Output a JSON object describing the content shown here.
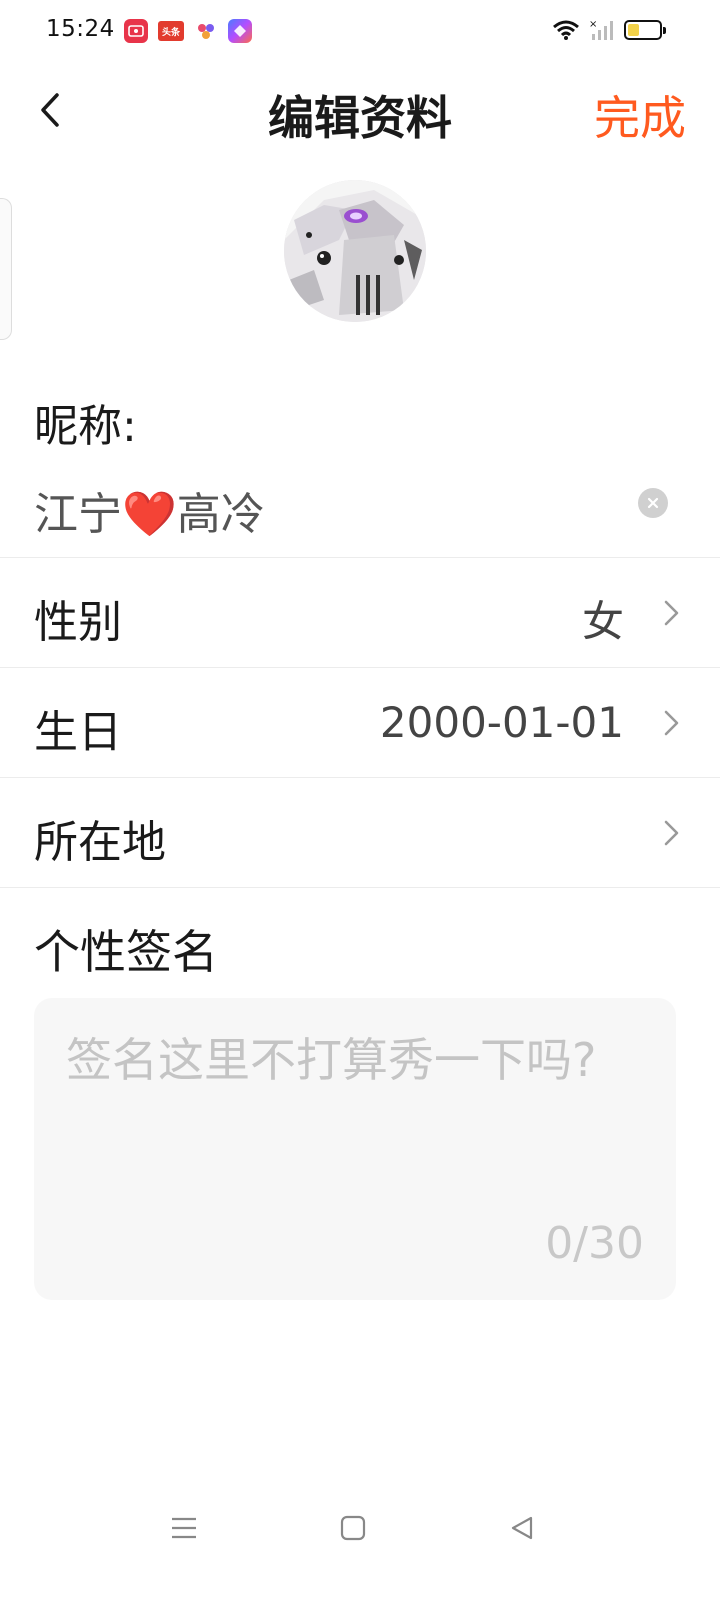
{
  "status_bar": {
    "time": "15:24",
    "app_icons": [
      "screen-record-icon",
      "toutiao-icon",
      "paw-app-icon",
      "assistant-app-icon"
    ],
    "toutiao_label": "头条",
    "battery_level": 0.35,
    "battery_color": "#f2d24a"
  },
  "header": {
    "title": "编辑资料",
    "done_label": "完成",
    "accent_color": "#ff5a1f"
  },
  "profile": {
    "nickname_label": "昵称:",
    "nickname_value": "江宁❤️高冷"
  },
  "rows": [
    {
      "label": "性别",
      "value": "女"
    },
    {
      "label": "生日",
      "value": "2000-01-01"
    },
    {
      "label": "所在地",
      "value": ""
    }
  ],
  "signature": {
    "label": "个性签名",
    "placeholder": "签名这里不打算秀一下吗?",
    "counter": "0/30"
  },
  "nav_bar": {
    "buttons": [
      "menu-icon",
      "home-square-icon",
      "back-triangle-icon"
    ]
  }
}
